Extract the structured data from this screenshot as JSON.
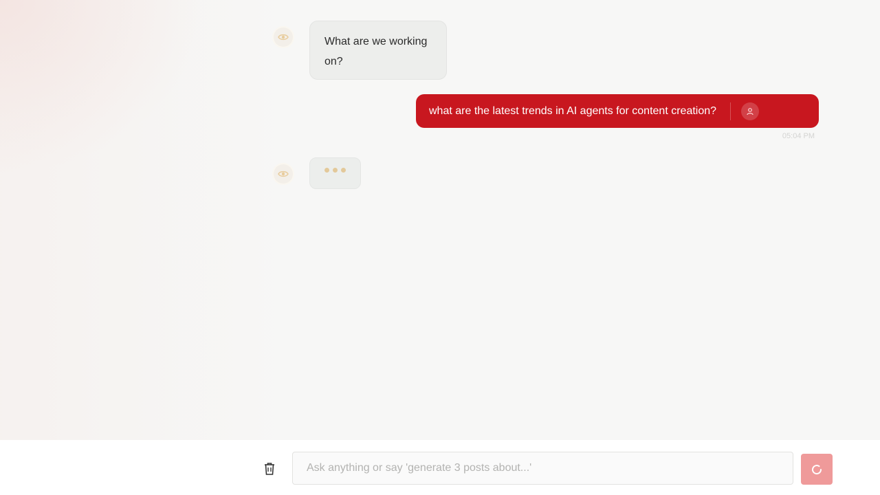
{
  "conversation": {
    "messages": [
      {
        "role": "assistant",
        "text": "What are we working on?",
        "icon": "eye-icon"
      },
      {
        "role": "user",
        "text": "what are the latest trends in AI agents for content creation?",
        "time": "05:04 PM",
        "icon": "user-icon"
      },
      {
        "role": "assistant",
        "typing": true,
        "icon": "eye-icon"
      }
    ]
  },
  "composer": {
    "placeholder": "Ask anything or say 'generate 3 posts about...'",
    "value": "",
    "clear_icon": "trash-icon",
    "send_state": "loading",
    "send_icon": "spinner-icon"
  },
  "colors": {
    "user_bubble": "#c8171f",
    "assistant_bubble": "#edeeec",
    "send_button": "#ef9a9a",
    "typing_dots": "#e3c99a"
  }
}
